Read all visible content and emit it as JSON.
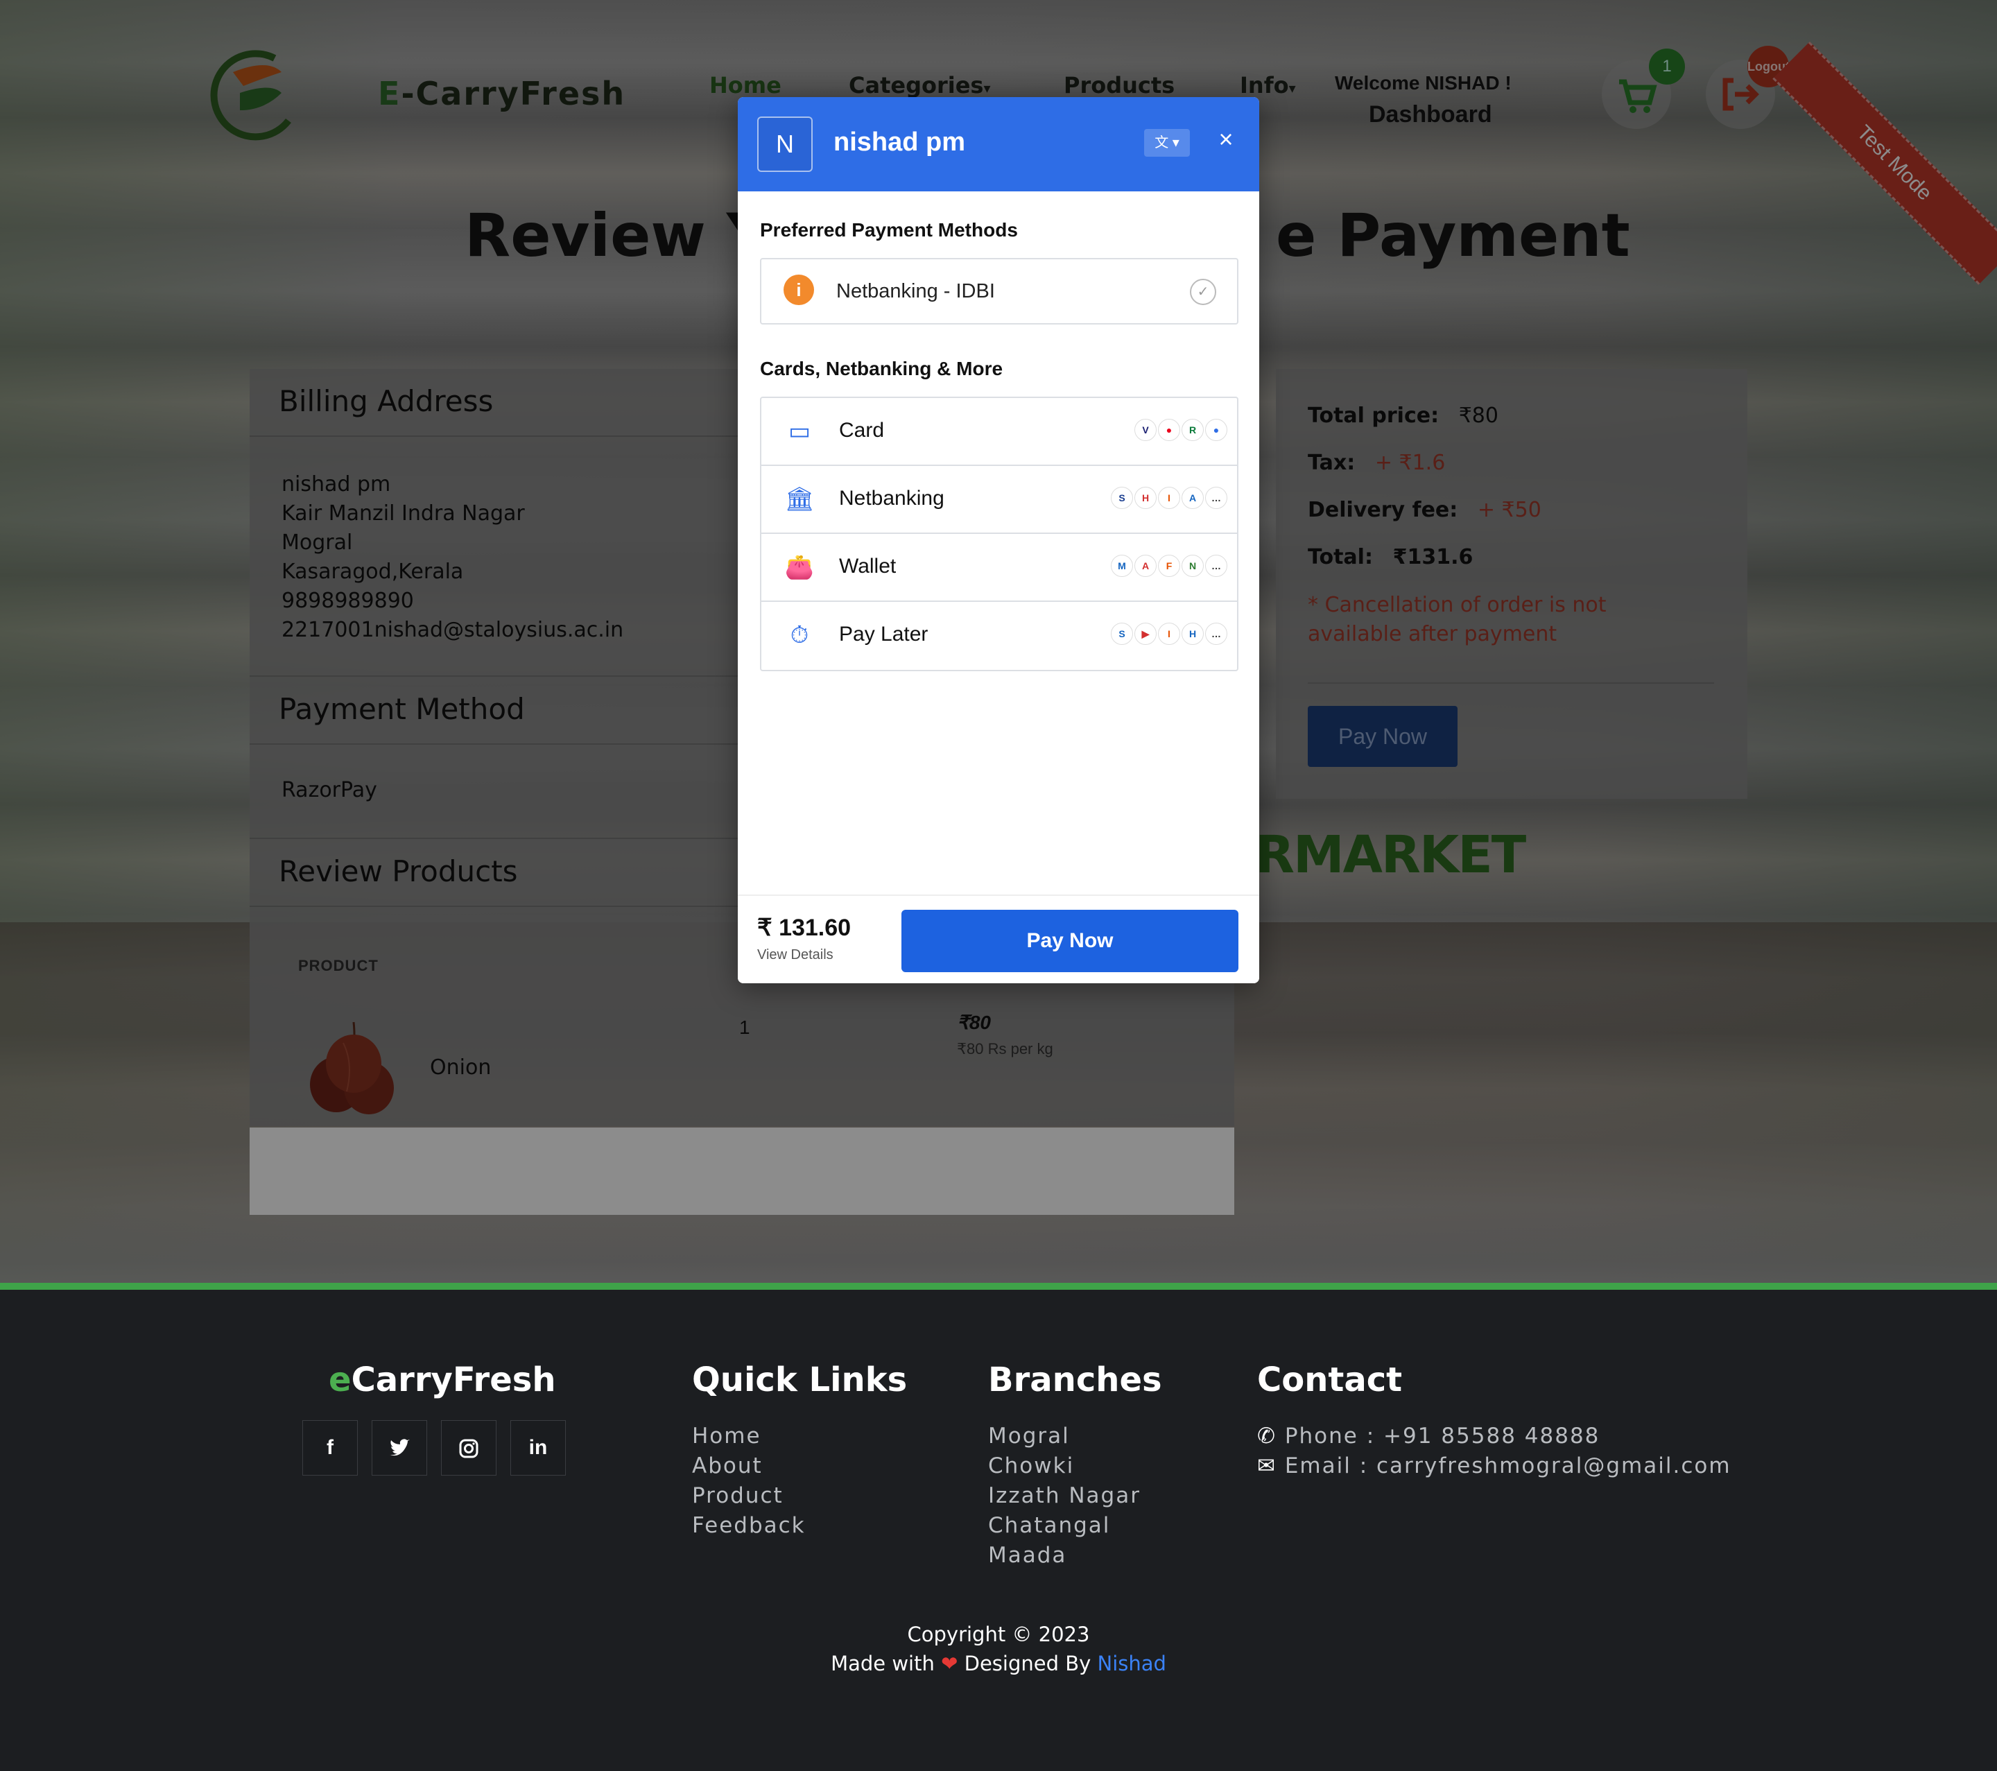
{
  "header": {
    "brand_prefix": "E",
    "brand_rest": "-CarryFresh",
    "nav": [
      "Home",
      "Categories",
      "Products",
      "Info"
    ],
    "welcome": "Welcome NISHAD !",
    "dashboard": "Dashboard",
    "cart_count": "1",
    "logout_label": "Logout",
    "ribbon": "Test Mode"
  },
  "page": {
    "title_left": "Review Yo",
    "title_right": "e Payment"
  },
  "billing": {
    "heading": "Billing Address",
    "lines": [
      "nishad pm",
      "Kair Manzil Indra Nagar",
      "Mogral",
      "Kasaragod,Kerala",
      "9898989890",
      "2217001nishad@staloysius.ac.in"
    ]
  },
  "payment_method": {
    "heading": "Payment Method",
    "value": "RazorPay"
  },
  "review": {
    "heading": "Review Products",
    "column_product": "PRODUCT",
    "item_name": "Onion",
    "item_qty": "1",
    "item_price": "₹80",
    "item_unit": "₹80 Rs per kg"
  },
  "summary": {
    "total_price_label": "Total price:",
    "total_price": "₹80",
    "tax_label": "Tax:",
    "tax": "+ ₹1.6",
    "delivery_label": "Delivery fee:",
    "delivery": "+ ₹50",
    "total_label": "Total:",
    "total": "₹131.6",
    "note": "* Cancellation of order is not available after payment",
    "pay_button": "Pay Now"
  },
  "background_text": "RMARKET",
  "modal": {
    "avatar_letter": "N",
    "name": "nishad pm",
    "lang_icon": "translate-icon",
    "preferred_heading": "Preferred Payment Methods",
    "preferred_item": "Netbanking - IDBI",
    "more_heading": "Cards, Netbanking & More",
    "methods": [
      {
        "label": "Card",
        "icon": "card-icon"
      },
      {
        "label": "Netbanking",
        "icon": "bank-icon"
      },
      {
        "label": "Wallet",
        "icon": "wallet-icon"
      },
      {
        "label": "Pay Later",
        "icon": "paylater-icon"
      }
    ],
    "amount": "₹ 131.60",
    "view_details": "View Details",
    "pay_button": "Pay Now"
  },
  "footer": {
    "brand_prefix": "e",
    "brand_rest": "CarryFresh",
    "quick_links_heading": "Quick Links",
    "quick_links": [
      "Home",
      "About",
      "Product",
      "Feedback"
    ],
    "branches_heading": "Branches",
    "branches": [
      "Mogral",
      "Chowki",
      "Izzath Nagar",
      "Chatangal",
      "Maada"
    ],
    "contact_heading": "Contact",
    "phone": "Phone : +91 85588 48888",
    "email": "Email : carryfreshmogral@gmail.com",
    "copyright": "Copyright © 2023",
    "made_with": "Made with",
    "designed_by": "Designed By",
    "designer": "Nishad"
  },
  "colors": {
    "accent_green": "#3fa349",
    "razorpay_blue": "#2e6de6",
    "alert_red": "#a33a2a",
    "footer_bg": "#1c1e21"
  }
}
